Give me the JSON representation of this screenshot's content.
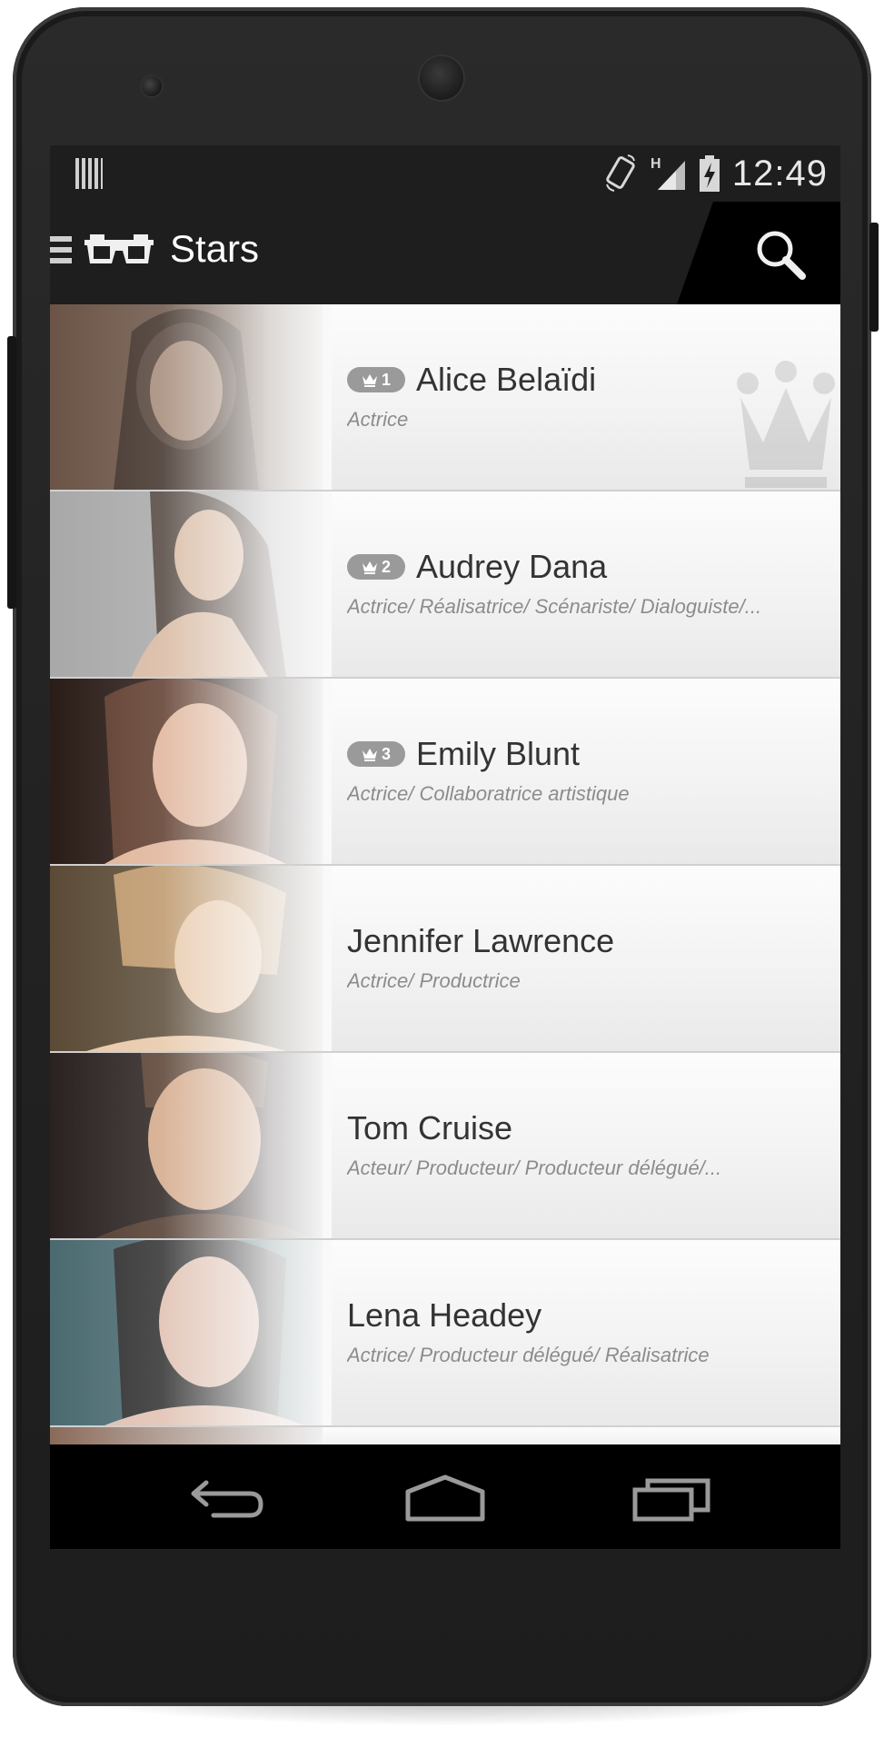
{
  "statusbar": {
    "time": "12:49",
    "network_type": "H"
  },
  "actionbar": {
    "title": "Stars"
  },
  "stars": [
    {
      "rank": "1",
      "name": "Alice Belaïdi",
      "roles": "Actrice",
      "photo_colors": [
        "#6b5446",
        "#2a1f1a",
        "#a58a78"
      ]
    },
    {
      "rank": "2",
      "name": "Audrey Dana",
      "roles": "Actrice/ Réalisatrice/ Scénariste/ Dialoguiste/...",
      "photo_colors": [
        "#a8a8a8",
        "#3b2a22",
        "#d8b8a0"
      ]
    },
    {
      "rank": "3",
      "name": "Emily Blunt",
      "roles": "Actrice/ Collaboratrice artistique",
      "photo_colors": [
        "#2a1c17",
        "#6b4331",
        "#e0b49a"
      ]
    },
    {
      "rank": "",
      "name": "Jennifer Lawrence",
      "roles": "Actrice/ Productrice",
      "photo_colors": [
        "#5a4a36",
        "#c8a070",
        "#e8c8a8"
      ]
    },
    {
      "rank": "",
      "name": "Tom Cruise",
      "roles": "Acteur/ Producteur/ Producteur délégué/...",
      "photo_colors": [
        "#2a2220",
        "#5a4030",
        "#d4a888"
      ]
    },
    {
      "rank": "",
      "name": "Lena Headey",
      "roles": "Actrice/ Producteur délégué/ Réalisatrice",
      "photo_colors": [
        "#4a6a70",
        "#2a2424",
        "#e0c0b0"
      ]
    }
  ]
}
